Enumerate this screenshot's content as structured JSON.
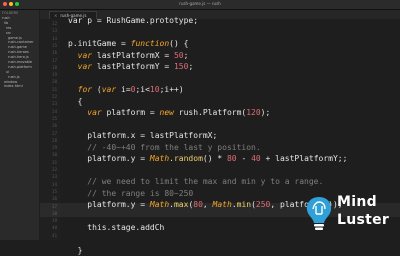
{
  "window": {
    "title": "rush-game.js — rush",
    "dot_colors": [
      "#ff5f57",
      "#febc2e",
      "#28c840"
    ]
  },
  "sidebar": {
    "header": "FOLDERS",
    "items": [
      "rush",
      "lib",
      "res",
      "src",
      "game.js",
      "rush-container",
      "rush-game",
      "rush-heroes",
      "rush-hero.js",
      "rush-movable",
      "rush-platform",
      "ui",
      "rush.js",
      "window",
      "index.html"
    ]
  },
  "tab": {
    "label": "rush-game.js",
    "close": "×"
  },
  "editor": {
    "line_numbers": [
      12,
      13,
      14,
      15,
      16,
      17,
      18,
      19,
      20,
      21,
      22,
      23,
      24,
      25,
      26,
      27,
      28,
      29,
      30,
      31,
      32,
      33,
      34,
      35,
      36,
      37,
      38,
      39,
      40,
      41
    ],
    "code_lines": [
      [
        [
          "pl",
          "var p = RushGame.prototype;"
        ]
      ],
      [],
      [
        [
          "pl",
          "p.initGame = "
        ],
        [
          "kw",
          "function"
        ],
        [
          "pl",
          "() {"
        ]
      ],
      [
        [
          "pl",
          "  "
        ],
        [
          "kw",
          "var"
        ],
        [
          "pl",
          " lastPlatformX = "
        ],
        [
          "cn",
          "50"
        ],
        [
          "pl",
          ";"
        ]
      ],
      [
        [
          "pl",
          "  "
        ],
        [
          "kw",
          "var"
        ],
        [
          "pl",
          " lastPlatformY = "
        ],
        [
          "cn",
          "150"
        ],
        [
          "pl",
          ";"
        ]
      ],
      [],
      [
        [
          "pl",
          "  "
        ],
        [
          "kw",
          "for"
        ],
        [
          "pl",
          " ("
        ],
        [
          "kw",
          "var"
        ],
        [
          "pl",
          " i="
        ],
        [
          "cn",
          "0"
        ],
        [
          "pl",
          ";i<"
        ],
        [
          "cn",
          "10"
        ],
        [
          "pl",
          ";i++)"
        ]
      ],
      [
        [
          "pl",
          "  {"
        ]
      ],
      [
        [
          "pl",
          "    "
        ],
        [
          "kw",
          "var"
        ],
        [
          "pl",
          " platform = "
        ],
        [
          "kw",
          "new"
        ],
        [
          "pl",
          " rush.Platform("
        ],
        [
          "cn",
          "120"
        ],
        [
          "pl",
          ");"
        ]
      ],
      [],
      [
        [
          "pl",
          "    platform.x = lastPlatformX;"
        ]
      ],
      [
        [
          "cm",
          "    // -40~+40 from the last y position."
        ]
      ],
      [
        [
          "pl",
          "    platform.y = "
        ],
        [
          "kw",
          "Math"
        ],
        [
          "pl",
          "."
        ],
        [
          "fn",
          "random"
        ],
        [
          "pl",
          "() * "
        ],
        [
          "cn",
          "80"
        ],
        [
          "pl",
          " - "
        ],
        [
          "cn",
          "40"
        ],
        [
          "pl",
          " + lastPlatformY;;"
        ]
      ],
      [],
      [
        [
          "cm",
          "    // we need to limit the max and min y to a range."
        ]
      ],
      [
        [
          "cm",
          "    // the range is 80~250"
        ]
      ],
      [
        [
          "pl",
          "    platform.y = "
        ],
        [
          "kw",
          "Math"
        ],
        [
          "pl",
          "."
        ],
        [
          "fn",
          "max"
        ],
        [
          "pl",
          "("
        ],
        [
          "cn",
          "80"
        ],
        [
          "pl",
          ", "
        ],
        [
          "kw",
          "Math"
        ],
        [
          "pl",
          "."
        ],
        [
          "fn",
          "min"
        ],
        [
          "pl",
          "("
        ],
        [
          "cn",
          "250"
        ],
        [
          "pl",
          ", platform.y));"
        ]
      ],
      [],
      [
        [
          "pl",
          "    this.stage.addCh"
        ]
      ],
      [],
      [
        [
          "pl",
          "  }"
        ]
      ]
    ]
  },
  "watermark": {
    "line1": "Mind",
    "line2": "Luster",
    "color": "#2fa0d8"
  }
}
